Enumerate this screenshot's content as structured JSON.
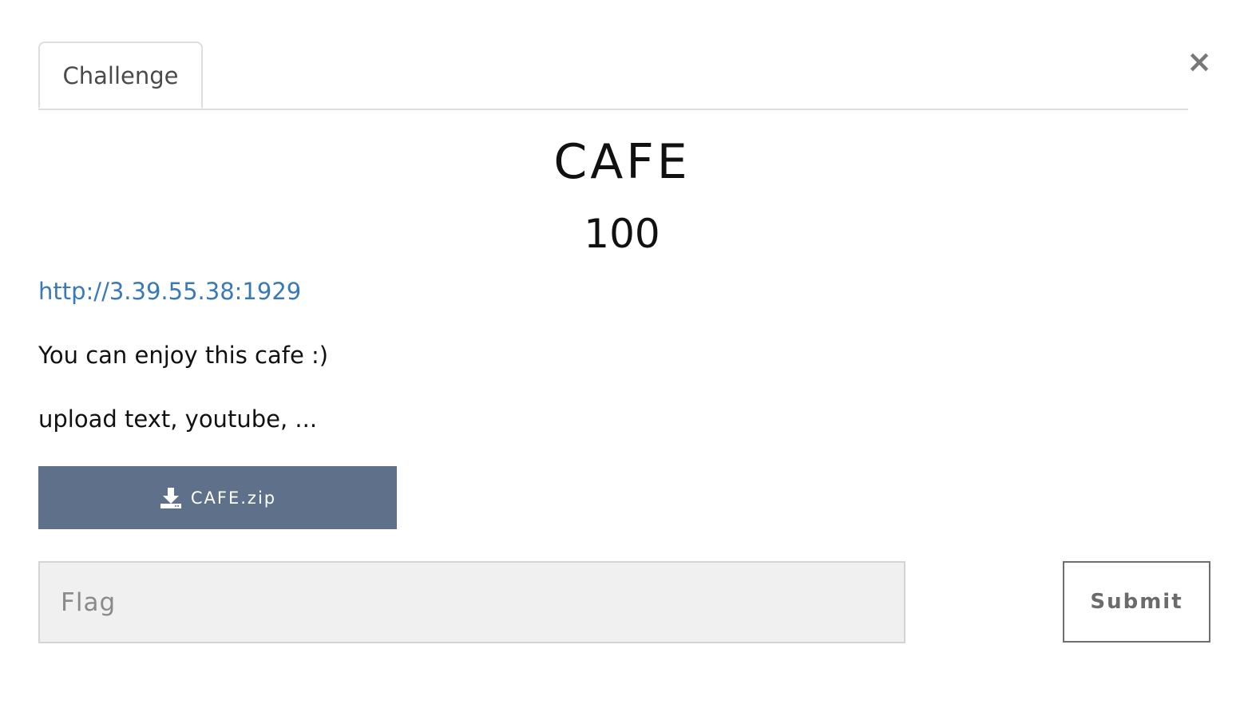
{
  "modal": {
    "close_glyph": "×",
    "tabs": [
      {
        "label": "Challenge"
      }
    ]
  },
  "challenge": {
    "name": "CAFE",
    "points": "100",
    "url": "http://3.39.55.38:1929",
    "description": [
      "You can enjoy this cafe :)",
      "upload text, youtube, ..."
    ],
    "file": {
      "icon": "download-icon",
      "label": "CAFE.zip"
    }
  },
  "submission": {
    "flag_placeholder": "Flag",
    "flag_value": "",
    "submit_label": "Submit"
  },
  "colors": {
    "download_button": "#5f708b",
    "link": "#3a79b7",
    "input_background": "#f0f0f0"
  }
}
